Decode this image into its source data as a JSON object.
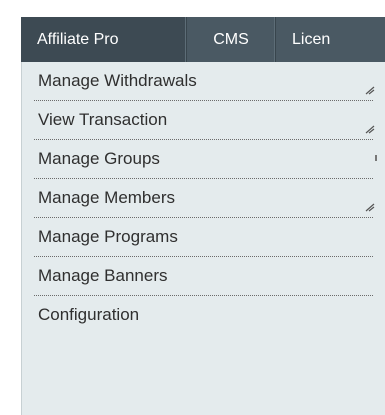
{
  "topnav": {
    "items": [
      {
        "label": "Affiliate Pro"
      },
      {
        "label": "CMS"
      },
      {
        "label": "Licen"
      }
    ]
  },
  "dropdown": {
    "items": [
      {
        "label": "Manage Withdrawals",
        "icon": "resize-grip-icon"
      },
      {
        "label": "View Transaction",
        "icon": "resize-grip-icon"
      },
      {
        "label": "Manage Groups",
        "icon": ""
      },
      {
        "label": "Manage Members",
        "icon": "resize-grip-icon"
      },
      {
        "label": "Manage Programs",
        "icon": ""
      },
      {
        "label": "Manage Banners",
        "icon": ""
      },
      {
        "label": "Configuration",
        "icon": ""
      }
    ]
  },
  "colors": {
    "nav_bg": "#4a5963",
    "nav_active_bg": "#3d4a53",
    "dropdown_bg": "#e4ebed",
    "text": "#2f2f2f"
  }
}
